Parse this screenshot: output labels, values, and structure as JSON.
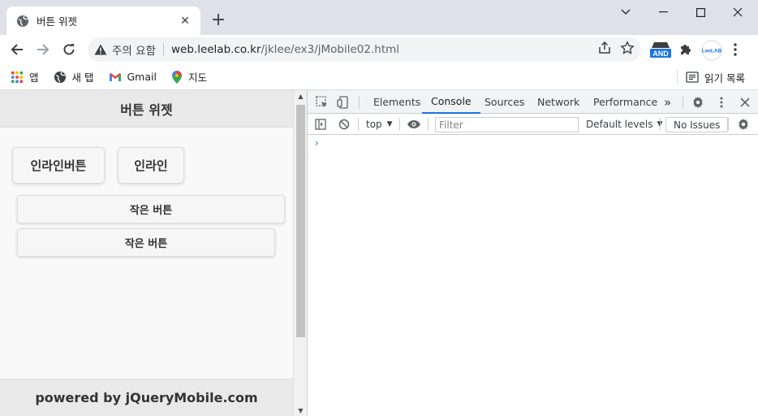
{
  "browser": {
    "tab_title": "버튼 위젯",
    "tab_close": "✕",
    "new_tab": "+",
    "security_label": "주의 요함",
    "url_host": "web.leelab.co.kr",
    "url_path": "/jklee/ex3/jMobile02.html",
    "extensions": {
      "and_badge": "AND",
      "leelab": "LeeLAB"
    },
    "bookmarks": [
      {
        "label": "앱"
      },
      {
        "label": "새 탭"
      },
      {
        "label": "Gmail"
      },
      {
        "label": "지도"
      }
    ],
    "reading_list": "읽기 목록"
  },
  "page": {
    "header_title": "버튼 위젯",
    "inline_button_1": "인라인버튼",
    "inline_button_2": "인라인",
    "mini_button_1": "작은 버튼",
    "mini_button_2": "작은 버튼",
    "footer_text": "powered by jQueryMobile.com"
  },
  "devtools": {
    "tabs": [
      "Elements",
      "Console",
      "Sources",
      "Network",
      "Performance"
    ],
    "more_tabs": "»",
    "context": "top",
    "filter_placeholder": "Filter",
    "levels": "Default levels",
    "issues": "No Issues",
    "prompt": "›"
  },
  "colors": {
    "accent": "#1a73e8",
    "tab_strip": "#dee1e6",
    "jqm_bar": "#e9e9e9"
  }
}
